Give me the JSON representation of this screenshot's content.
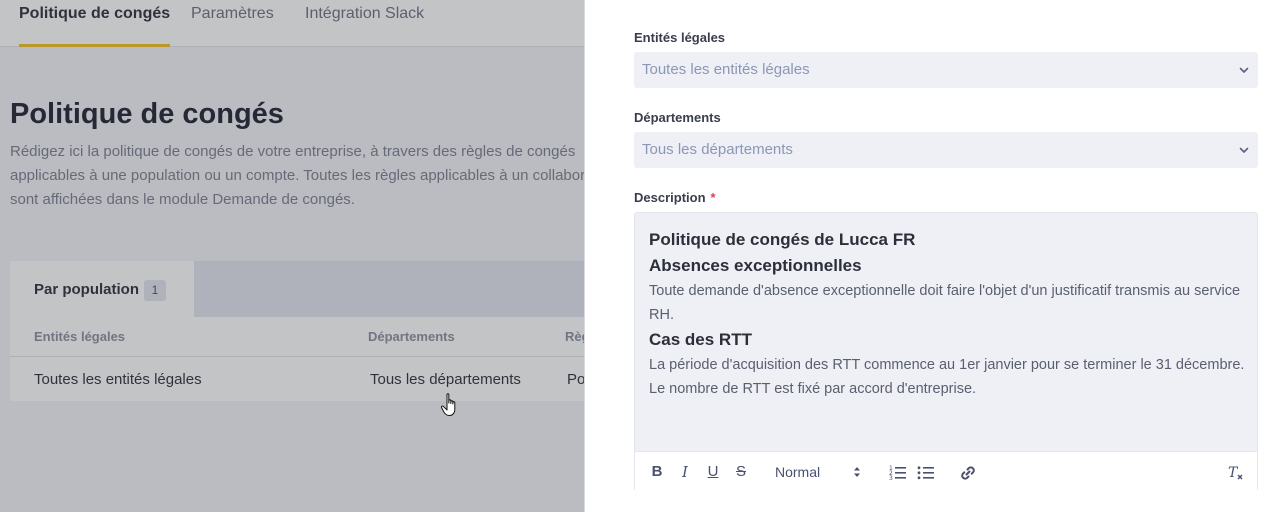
{
  "tabs": [
    {
      "label": "Politique de congés",
      "active": true
    },
    {
      "label": "Paramètres",
      "active": false
    },
    {
      "label": "Intégration Slack",
      "active": false
    }
  ],
  "page": {
    "title": "Politique de congés",
    "description": "Rédigez ici la politique de congés de votre entreprise, à travers des règles de congés applicables à une population ou un compte. Toutes les règles applicables à un collaborateur sont affichées dans le module Demande de congés."
  },
  "card": {
    "tab_label": "Par population",
    "tab_count": "1",
    "columns": [
      "Entités légales",
      "Départements",
      "Règles"
    ],
    "rows": [
      {
        "entities": "Toutes les entités légales",
        "departments": "Tous les départements",
        "rules": "Politique de congés de Lucca FR"
      }
    ]
  },
  "panel": {
    "entities_label": "Entités légales",
    "entities_value": "Toutes les entités légales",
    "departments_label": "Départements",
    "departments_value": "Tous les départements",
    "description_label": "Description",
    "required_mark": "*",
    "editor": {
      "heading1": "Politique de congés de Lucca FR",
      "heading2": "Absences exceptionnelles",
      "para1": "Toute demande d'absence exceptionnelle doit faire l'objet d'un justificatif transmis au service RH.",
      "heading3": "Cas des RTT",
      "para2": "La période d'acquisition des RTT commence au 1er janvier pour se terminer le 31 décembre.",
      "para3": "Le nombre de RTT est fixé par accord d'entreprise."
    },
    "toolbar": {
      "bold": "B",
      "italic": "I",
      "underline": "U",
      "strike": "S",
      "format": "Normal"
    }
  },
  "colors": {
    "accent": "#f4c020",
    "required": "#e0405a",
    "field_bg": "#eef0f6"
  }
}
